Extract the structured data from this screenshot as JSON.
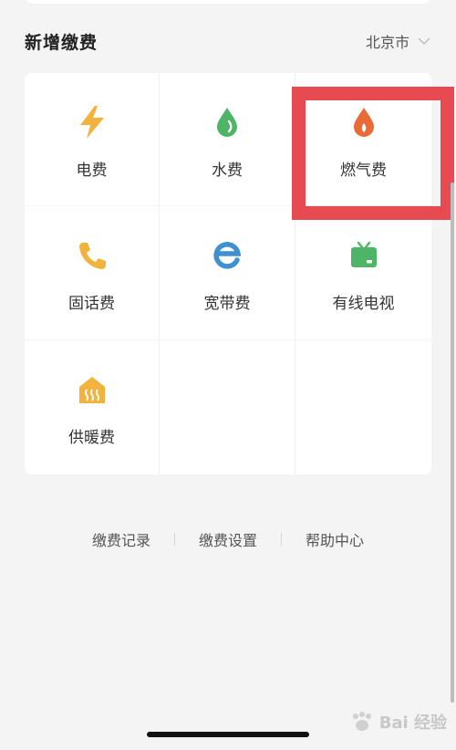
{
  "section": {
    "title": "新增缴费",
    "city": "北京市"
  },
  "services": [
    {
      "label": "电费",
      "icon": "lightning-icon",
      "color": "#f2b33d"
    },
    {
      "label": "水费",
      "icon": "water-drop-icon",
      "color": "#4fb566"
    },
    {
      "label": "燃气费",
      "icon": "gas-flame-icon",
      "color": "#ea6a37"
    },
    {
      "label": "固话费",
      "icon": "phone-icon",
      "color": "#f2b33d"
    },
    {
      "label": "宽带费",
      "icon": "broadband-e-icon",
      "color": "#3f90d0"
    },
    {
      "label": "有线电视",
      "icon": "tv-icon",
      "color": "#4fb566"
    },
    {
      "label": "供暖费",
      "icon": "heating-house-icon",
      "color": "#f2b33d"
    }
  ],
  "footer": {
    "records": "缴费记录",
    "settings": "缴费设置",
    "help": "帮助中心"
  },
  "highlight_color": "#e84a52",
  "watermark": {
    "text": "Bai 经验"
  }
}
